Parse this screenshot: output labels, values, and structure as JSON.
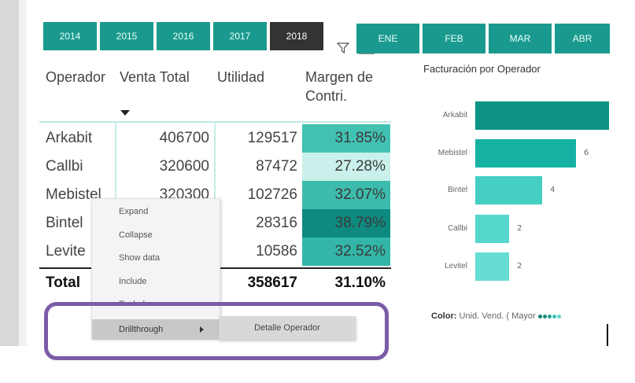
{
  "years": [
    "2014",
    "2015",
    "2016",
    "2017",
    "2018"
  ],
  "selected_year": "2018",
  "months": [
    "ENE",
    "FEB",
    "MAR",
    "ABR"
  ],
  "table": {
    "headers": [
      "Operador",
      "Venta Total",
      "Utilidad",
      "Margen de Contri."
    ],
    "rows": [
      {
        "operador": "Arkabit",
        "venta": "406700",
        "utilidad": "129517",
        "margen": "31.85%",
        "color": "#42c1b3"
      },
      {
        "operador": "Callbi",
        "venta": "320600",
        "utilidad": "87472",
        "margen": "27.28%",
        "color": "#c9f0ea"
      },
      {
        "operador": "Mebistel",
        "venta": "320300",
        "utilidad": "102726",
        "margen": "32.07%",
        "color": "#3dbbad"
      },
      {
        "operador": "Bintel",
        "venta": "",
        "utilidad": "28316",
        "margen": "38.79%",
        "color": "#0e8a80"
      },
      {
        "operador": "Levite",
        "venta": "",
        "utilidad": "10586",
        "margen": "32.52%",
        "color": "#33b6a8"
      }
    ],
    "total": {
      "label": "Total",
      "utilidad": "358617",
      "margen": "31.10%"
    }
  },
  "chart": {
    "title": "Facturación por Operador",
    "bars": [
      {
        "label": "Arkabit",
        "value": 8,
        "value_label": "",
        "color": "#0d9384"
      },
      {
        "label": "Mebistel",
        "value": 6,
        "value_label": "6",
        "color": "#16b3a5"
      },
      {
        "label": "Bintel",
        "value": 4,
        "value_label": "4",
        "color": "#45cfc3"
      },
      {
        "label": "Callbi",
        "value": 2,
        "value_label": "2",
        "color": "#55d7cc"
      },
      {
        "label": "Levitel",
        "value": 2,
        "value_label": "2",
        "color": "#66ddd2"
      }
    ],
    "legend": {
      "title": "Color",
      "text": "Unid. Vend. ( Mayor",
      "dot_colors": [
        "#0e7d73",
        "#168f84",
        "#22a397",
        "#38bcb0",
        "#5dd6ca"
      ]
    }
  },
  "context_menu": {
    "items": [
      "Expand",
      "Collapse",
      "Show data",
      "Include",
      "Exclude",
      "Drillthrough"
    ],
    "highlighted": "Drillthrough",
    "submenu": "Detalle Operador"
  },
  "colors": {
    "accent": "#1a9a8e",
    "selected": "#333333",
    "highlight_border": "#7b5ca8"
  }
}
